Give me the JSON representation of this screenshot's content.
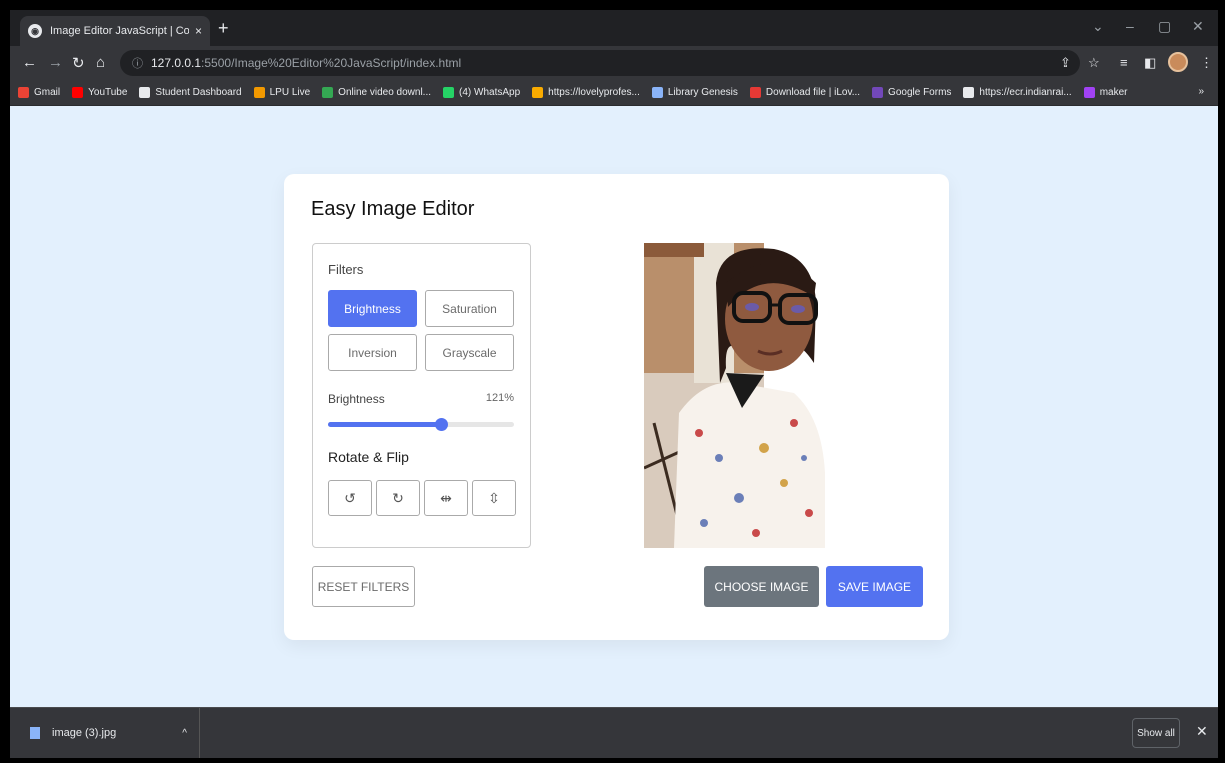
{
  "browser": {
    "tab_title": "Image Editor JavaScript | Coding",
    "tab_close": "×",
    "new_tab": "+",
    "url_host": "127.0.0.1",
    "url_path": ":5500/Image%20Editor%20JavaScript/index.html",
    "window_controls": [
      "⌄",
      "–",
      "▢",
      "✕"
    ],
    "bookmarks": [
      {
        "label": "Gmail",
        "color": "#ea4335"
      },
      {
        "label": "YouTube",
        "color": "#ff0000"
      },
      {
        "label": "Student Dashboard",
        "color": "#e8eaed"
      },
      {
        "label": "LPU Live",
        "color": "#f29900"
      },
      {
        "label": "Online video downl...",
        "color": "#34a853"
      },
      {
        "label": "(4) WhatsApp",
        "color": "#25d366"
      },
      {
        "label": "https://lovelyprofes...",
        "color": "#f9ab00"
      },
      {
        "label": "Library Genesis",
        "color": "#8ab4f8"
      },
      {
        "label": "Download file | iLov...",
        "color": "#e53935"
      },
      {
        "label": "Google Forms",
        "color": "#7248b9"
      },
      {
        "label": "https://ecr.indianrai...",
        "color": "#e8eaed"
      },
      {
        "label": "maker",
        "color": "#a142f4"
      }
    ],
    "bookmarks_more": "»"
  },
  "editor": {
    "title": "Easy Image Editor",
    "filters_label": "Filters",
    "filter_buttons": [
      "Brightness",
      "Saturation",
      "Inversion",
      "Grayscale"
    ],
    "active_filter": "Brightness",
    "slider_name": "Brightness",
    "slider_value": "121%",
    "slider_value_num": 121,
    "slider_max": 200,
    "rotate_label": "Rotate & Flip",
    "rotate_icons": [
      "↺",
      "↻",
      "⇹",
      "⇳"
    ],
    "reset_label": "RESET FILTERS",
    "choose_label": "CHOOSE IMAGE",
    "save_label": "SAVE IMAGE"
  },
  "download": {
    "filename": "image (3).jpg",
    "chevron": "^",
    "show_all": "Show all",
    "close": "✕"
  },
  "colors": {
    "accent": "#5372f0",
    "choose": "#6c757d",
    "page_bg": "#e3f0fd"
  }
}
